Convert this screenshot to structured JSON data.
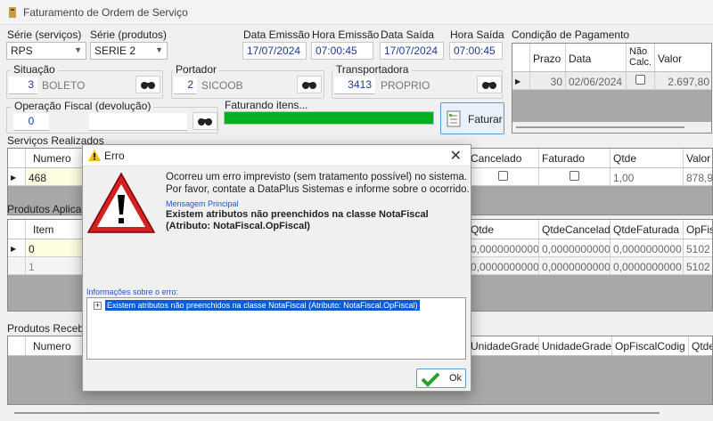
{
  "window": {
    "title": "Faturamento de Ordem de Serviço"
  },
  "header": {
    "serie_servicos_label": "Série (serviços)",
    "serie_servicos_value": "RPS",
    "serie_produtos_label": "Série (produtos)",
    "serie_produtos_value": "SERIE 2",
    "data_emissao_label": "Data Emissão",
    "data_emissao_value": "17/07/2024",
    "hora_emissao_label": "Hora Emissão",
    "hora_emissao_value": "07:00:45",
    "data_saida_label": "Data Saída",
    "data_saida_value": "17/07/2024",
    "hora_saida_label": "Hora Saída",
    "hora_saida_value": "07:00:45"
  },
  "situacao": {
    "label": "Situação",
    "code": "3",
    "name": "BOLETO"
  },
  "portador": {
    "label": "Portador",
    "code": "2",
    "name": "SICOOB"
  },
  "transportadora": {
    "label": "Transportadora",
    "code": "3413",
    "name": "PROPRIO"
  },
  "operacao_fiscal": {
    "label": "Operação Fiscal (devolução)",
    "code": "0"
  },
  "faturando": {
    "label": "Faturando itens...",
    "progress_fraction": 1.0
  },
  "faturar_button": {
    "label": "Faturar"
  },
  "condicao_pagamento": {
    "label": "Condição de Pagamento",
    "columns": [
      "Prazo",
      "Data",
      "Não Calc.",
      "Valor"
    ],
    "col_nao_line1": "Não",
    "col_nao_line2": "Calc.",
    "rows": [
      {
        "prazo": "30",
        "data": "02/06/2024",
        "valor": "2.697,80"
      }
    ]
  },
  "servicos": {
    "label": "Serviços Realizados",
    "columns": {
      "numero": "Numero",
      "cancelado": "Cancelado",
      "faturado": "Faturado",
      "qtde": "Qtde",
      "valor": "Valor"
    },
    "row": {
      "numero": "468",
      "qtde": "1,00",
      "valor": "878,90"
    }
  },
  "produtos_aplicados": {
    "label": "Produtos Aplicad",
    "columns": {
      "item": "Item",
      "qtde": "Qtde",
      "qtde_cancelada": "QtdeCancelada",
      "qtde_faturada": "QtdeFaturada",
      "opfis": "OpFis"
    },
    "rows": [
      {
        "item": "0",
        "qtde": "0,0000000000",
        "qtde_cancelada": "0,0000000000",
        "qtde_faturada": "0,0000000000",
        "opfis": "5102"
      },
      {
        "item": "1",
        "qtde": "0,0000000000",
        "qtde_cancelada": "0,0000000000",
        "qtde_faturada": "0,0000000000",
        "opfis": "5102"
      }
    ]
  },
  "produtos_recebidos": {
    "label": "Produtos Recebi",
    "columns": {
      "numero": "Numero",
      "unidade_grade1": "UnidadeGrade",
      "unidade_grade2": "UnidadeGrade",
      "opfiscal_codigo": "OpFiscalCodig",
      "qtde": "Qtde"
    }
  },
  "error_dialog": {
    "title": "Erro",
    "message_line1": "Ocorreu um erro imprevisto (sem tratamento possível) no sistema.",
    "message_line2": "Por favor, contate a DataPlus Sistemas e informe sobre o ocorrido.",
    "main_message_label": "Mensagem Principal",
    "main_message_line1": "Existem atributos não preenchidos na classe NotaFiscal",
    "main_message_line2": "(Atributo: NotaFiscal.OpFiscal)",
    "info_label": "Informações sobre o erro:",
    "info_item": "Existem atributos não preenchidos na classe NotaFiscal (Atributo: NotaFiscal.OpFiscal)",
    "ok_label": "Ok"
  }
}
